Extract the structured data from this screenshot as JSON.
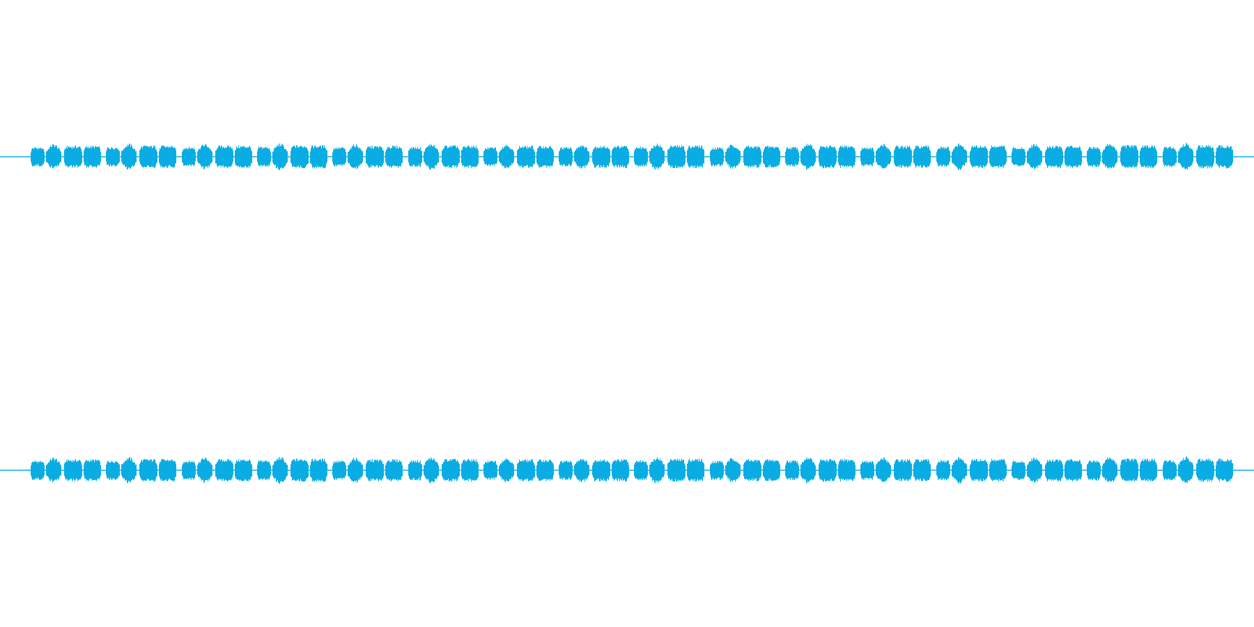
{
  "channels": [
    {
      "kind": "waveform"
    },
    {
      "kind": "waveform"
    }
  ]
}
